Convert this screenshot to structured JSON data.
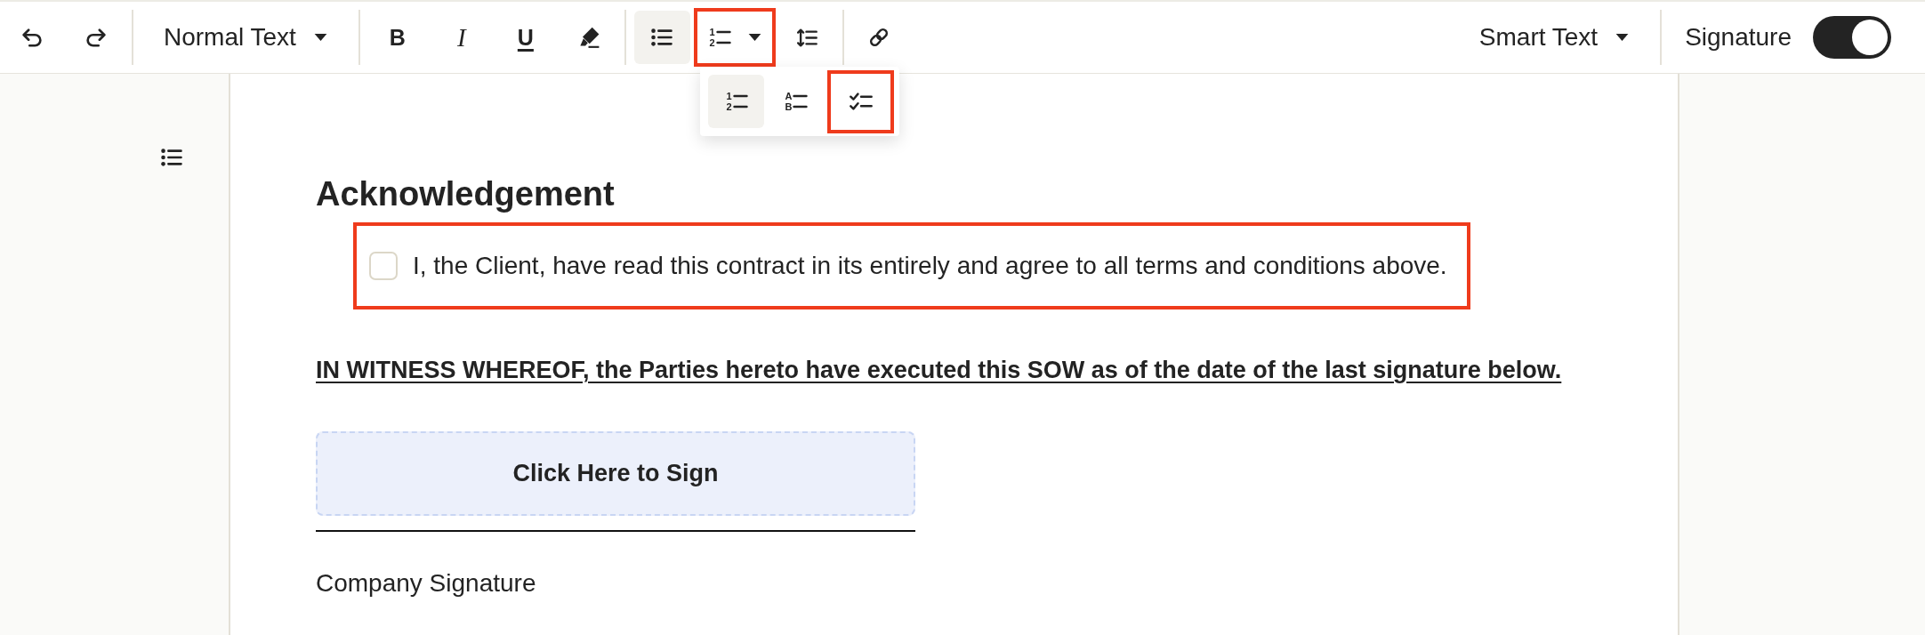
{
  "toolbar": {
    "text_style": {
      "label": "Normal Text"
    },
    "format_buttons": [
      {
        "kind": "bold",
        "glyph": "B"
      },
      {
        "kind": "italic",
        "glyph": "I"
      },
      {
        "kind": "underline",
        "glyph": "U"
      },
      {
        "kind": "highlight"
      }
    ],
    "list_buttons": [
      {
        "kind": "bullet",
        "active": true,
        "highlighted": false,
        "dropdown": false
      },
      {
        "kind": "numbered",
        "markers": [
          "1",
          "2"
        ],
        "active": false,
        "highlighted": true,
        "dropdown": true
      },
      {
        "kind": "line_spacing",
        "active": false,
        "highlighted": false,
        "dropdown": false
      }
    ],
    "smart_text": {
      "label": "Smart Text"
    },
    "signature": {
      "label": "Signature",
      "on": true
    }
  },
  "list_menu": {
    "options": [
      {
        "kind": "numbered",
        "markers": [
          "1",
          "2"
        ],
        "selected": true,
        "highlighted": false
      },
      {
        "kind": "lettered",
        "markers": [
          "A",
          "B"
        ],
        "selected": false,
        "highlighted": false
      },
      {
        "kind": "checklist",
        "selected": false,
        "highlighted": true
      }
    ]
  },
  "document": {
    "heading": "Acknowledgement",
    "checklist": [
      {
        "text": "I, the Client, have read this contract in its entirely and agree to all terms and conditions above.",
        "checked": false,
        "highlighted": true
      }
    ],
    "witness_clause": "IN WITNESS WHEREOF, the Parties hereto have executed this SOW as of the date of the last signature below.",
    "sign_field": {
      "label": "Click Here to Sign"
    },
    "signature_caption": "Company Signature"
  }
}
